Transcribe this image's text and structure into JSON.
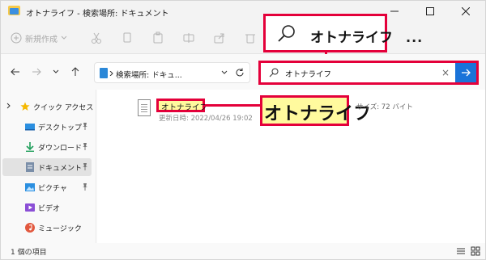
{
  "window": {
    "title": "オトナライフ - 検索場所: ドキュメント"
  },
  "toolbar": {
    "new_label": "新規作成",
    "more_label": "..."
  },
  "callout_search": {
    "text": "オトナライフ"
  },
  "address": {
    "path": "検索場所: ドキュ..."
  },
  "search": {
    "value": "オトナライフ"
  },
  "sidebar": {
    "items": [
      {
        "label": "クイック アクセス",
        "icon": "star-icon"
      },
      {
        "label": "デスクトップ",
        "icon": "desktop-icon"
      },
      {
        "label": "ダウンロード",
        "icon": "download-icon"
      },
      {
        "label": "ドキュメント",
        "icon": "document-icon"
      },
      {
        "label": "ピクチャ",
        "icon": "picture-icon"
      },
      {
        "label": "ビデオ",
        "icon": "video-icon"
      },
      {
        "label": "ミュージック",
        "icon": "music-icon"
      }
    ]
  },
  "result": {
    "name": "オトナライフ",
    "date": "更新日時: 2022/04/26 19:02",
    "size": "サイズ: 72 バイト"
  },
  "callout_name": {
    "text": "オトナライフ"
  },
  "status": {
    "count": "1 個の項目"
  },
  "colors": {
    "highlight_border": "#e4003a",
    "highlight_fill": "#fffa9e",
    "accent": "#1a73d9"
  }
}
